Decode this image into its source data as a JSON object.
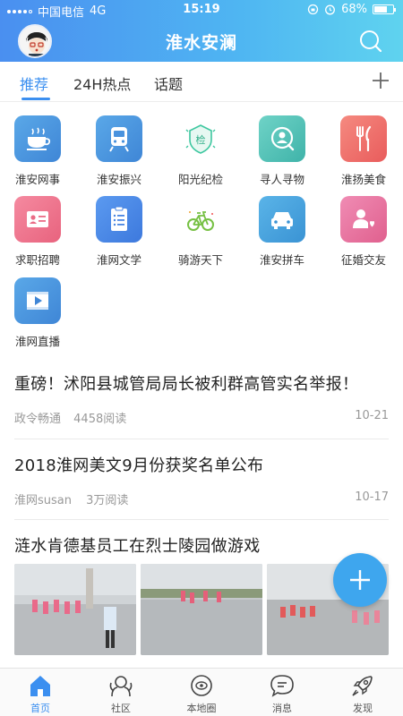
{
  "status_bar": {
    "carrier": "中国电信",
    "network": "4G",
    "time": "15:19",
    "battery": "68%",
    "battery_level": 0.68
  },
  "header": {
    "title": "淮水安澜"
  },
  "tabs": [
    {
      "label": "推荐",
      "active": true
    },
    {
      "label": "24H热点",
      "active": false
    },
    {
      "label": "话题",
      "active": false
    }
  ],
  "grid": [
    {
      "label": "淮安网事",
      "icon": "coffee-icon",
      "color": "#4f9be0"
    },
    {
      "label": "淮安振兴",
      "icon": "train-icon",
      "color": "#4f9be0"
    },
    {
      "label": "阳光纪检",
      "icon": "inspection-badge-icon",
      "color": "#3ec7a0"
    },
    {
      "label": "寻人寻物",
      "icon": "person-search-icon",
      "color": "#4fc2b7"
    },
    {
      "label": "淮扬美食",
      "icon": "fork-knife-icon",
      "color": "#f06a6a"
    },
    {
      "label": "求职招聘",
      "icon": "id-card-icon",
      "color": "#ef6f87"
    },
    {
      "label": "淮网文学",
      "icon": "document-list-icon",
      "color": "#4f8fe8"
    },
    {
      "label": "骑游天下",
      "icon": "bicycle-icon",
      "color": "#76c043"
    },
    {
      "label": "淮安拼车",
      "icon": "car-icon",
      "color": "#4aa2dc"
    },
    {
      "label": "征婚交友",
      "icon": "heart-person-icon",
      "color": "#e96ea0"
    },
    {
      "label": "淮网直播",
      "icon": "video-play-icon",
      "color": "#4f9be0"
    }
  ],
  "news": [
    {
      "title": "重磅！沭阳县城管局局长被利群高管实名举报！",
      "source": "政令畅通",
      "reads": "4458阅读",
      "date": "10-21"
    },
    {
      "title": "2018淮网美文9月份获奖名单公布",
      "source": "淮网susan",
      "reads": "3万阅读",
      "date": "10-17"
    },
    {
      "title": "涟水肯德基员工在烈士陵园做游戏"
    }
  ],
  "bottom_nav": [
    {
      "label": "首页",
      "icon": "home-icon",
      "active": true
    },
    {
      "label": "社区",
      "icon": "community-icon",
      "active": false
    },
    {
      "label": "本地圈",
      "icon": "local-circle-icon",
      "active": false
    },
    {
      "label": "消息",
      "icon": "message-icon",
      "active": false
    },
    {
      "label": "发现",
      "icon": "rocket-icon",
      "active": false
    }
  ],
  "colors": {
    "accent": "#3b8ff0",
    "fab": "#3ea6ee"
  }
}
